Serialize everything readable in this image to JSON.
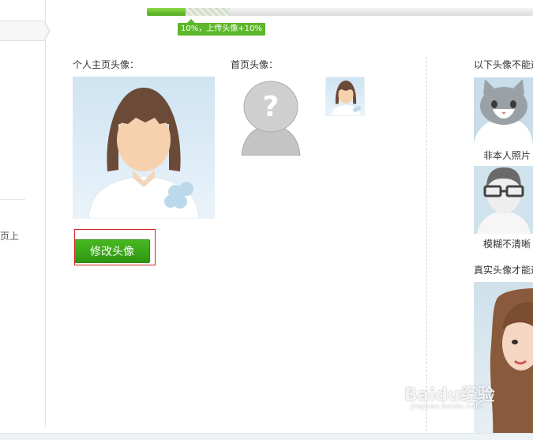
{
  "progress": {
    "percent": 10,
    "tag": "10%，上传头像+10%"
  },
  "sidebar": {
    "cut_text": "页上"
  },
  "avatar": {
    "profile_label": "个人主页头像：",
    "home_label": "首页头像：",
    "edit_button": "修改头像"
  },
  "examples": {
    "bad_title": "以下头像不能通",
    "cat_caption": "非本人照片",
    "blur_caption": "模糊不清晰",
    "good_title": "真实头像才能通"
  },
  "watermark": {
    "logo": "Baidu经验",
    "url": "jingyan.baidu.com"
  },
  "colors": {
    "accent_green": "#3aa81a",
    "highlight_red": "#d62222",
    "avatar_bg": "#d8e9f5"
  }
}
